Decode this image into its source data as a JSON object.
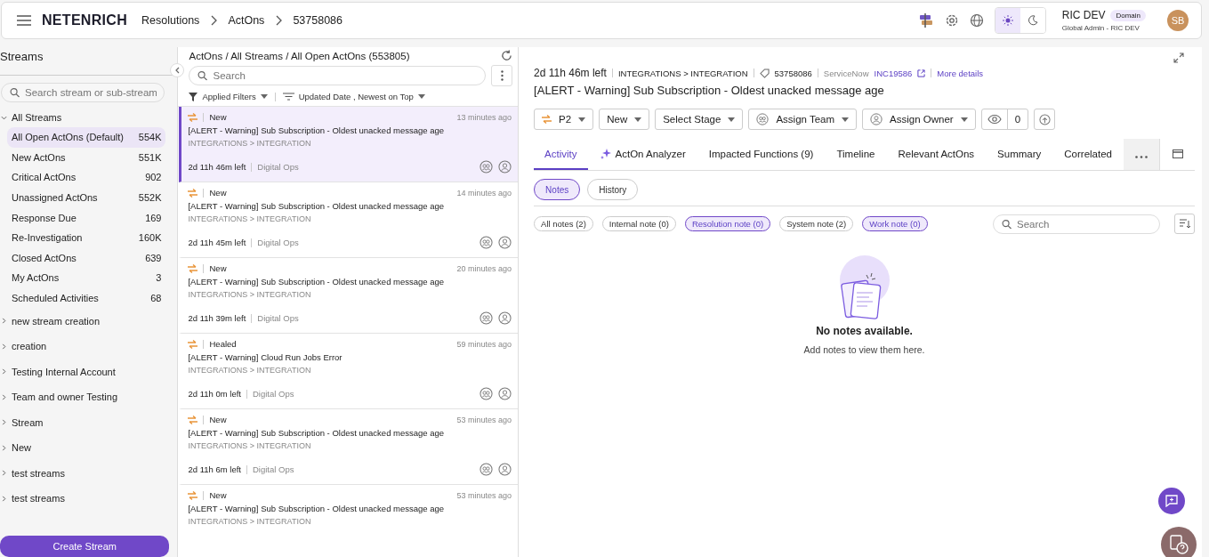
{
  "header": {
    "logo": "NETENRICH",
    "breadcrumbs": [
      "Resolutions",
      "ActOns",
      "53758086"
    ],
    "user": {
      "name": "RIC DEV",
      "badge": "Domain",
      "role": "Global Admin - RIC DEV",
      "initials": "SB"
    },
    "theme": {
      "light_selected": true
    }
  },
  "sidebar": {
    "title": "Streams",
    "search": {
      "placeholder": "Search stream or sub-stream"
    },
    "streams": [
      {
        "label": "All Streams",
        "expanded": true,
        "children": [
          {
            "label": "All Open ActOns (Default)",
            "count": "554K",
            "selected": true
          },
          {
            "label": "New ActOns",
            "count": "551K",
            "selected": false
          },
          {
            "label": "Critical ActOns",
            "count": "902",
            "selected": false
          },
          {
            "label": "Unassigned ActOns",
            "count": "552K",
            "selected": false
          },
          {
            "label": "Response Due",
            "count": "169",
            "selected": false
          },
          {
            "label": "Re-Investigation",
            "count": "160K",
            "selected": false
          },
          {
            "label": "Closed ActOns",
            "count": "639",
            "selected": false
          },
          {
            "label": "My ActOns",
            "count": "3",
            "selected": false
          },
          {
            "label": "Scheduled Activities",
            "count": "68",
            "selected": false
          }
        ]
      },
      {
        "label": "new stream creation",
        "expanded": false
      },
      {
        "label": "creation",
        "expanded": false
      },
      {
        "label": "Testing Internal Account",
        "expanded": false
      },
      {
        "label": "Team and owner Testing",
        "expanded": false
      },
      {
        "label": "Stream",
        "expanded": false
      },
      {
        "label": "New",
        "expanded": false
      },
      {
        "label": "test streams",
        "expanded": false
      },
      {
        "label": "test streams",
        "expanded": false
      }
    ],
    "create_button": "Create Stream"
  },
  "list": {
    "path": "ActOns / All Streams / All Open ActOns (553805)",
    "search": {
      "placeholder": "Search"
    },
    "filter": "Applied Filters",
    "sort": "Updated Date , Newest on Top",
    "items": [
      {
        "status": "New",
        "time": "13 minutes ago",
        "title": "[ALERT - Warning] Sub Subscription - Oldest unacked message age",
        "category": "INTEGRATIONS > INTEGRATION",
        "due": "2d 11h 46m left",
        "team": "Digital Ops",
        "selected": true
      },
      {
        "status": "New",
        "time": "14 minutes ago",
        "title": "[ALERT - Warning] Sub Subscription - Oldest unacked message age",
        "category": "INTEGRATIONS > INTEGRATION",
        "due": "2d 11h 45m left",
        "team": "Digital Ops",
        "selected": false
      },
      {
        "status": "New",
        "time": "20 minutes ago",
        "title": "[ALERT - Warning] Sub Subscription - Oldest unacked message age",
        "category": "INTEGRATIONS > INTEGRATION",
        "due": "2d 11h 39m left",
        "team": "Digital Ops",
        "selected": false
      },
      {
        "status": "Healed",
        "time": "59 minutes ago",
        "title": "[ALERT - Warning] Cloud Run Jobs Error",
        "category": "INTEGRATIONS > INTEGRATION",
        "due": "2d 11h 0m left",
        "team": "Digital Ops",
        "selected": false
      },
      {
        "status": "New",
        "time": "53 minutes ago",
        "title": "[ALERT - Warning] Sub Subscription - Oldest unacked message age",
        "category": "INTEGRATIONS > INTEGRATION",
        "due": "2d 11h 6m left",
        "team": "Digital Ops",
        "selected": false
      },
      {
        "status": "New",
        "time": "53 minutes ago",
        "title": "[ALERT - Warning] Sub Subscription - Oldest unacked message age",
        "category": "INTEGRATIONS > INTEGRATION",
        "selected": false
      }
    ]
  },
  "detail": {
    "due": "2d 11h 46m left",
    "category": "INTEGRATIONS > INTEGRATION",
    "id": "53758086",
    "source": "ServiceNow",
    "ticket": "INC19586",
    "more": "More details",
    "title": "[ALERT - Warning] Sub Subscription - Oldest unacked message age",
    "actions": [
      {
        "kind": "priority",
        "label": "P2"
      },
      {
        "kind": "dropdown",
        "label": "New"
      },
      {
        "kind": "dropdown",
        "label": "Select Stage"
      },
      {
        "kind": "team",
        "label": "Assign Team"
      },
      {
        "kind": "owner",
        "label": "Assign Owner"
      },
      {
        "kind": "views",
        "label": "0"
      },
      {
        "kind": "extra"
      }
    ],
    "tabs": [
      {
        "label": "Activity",
        "selected": true
      },
      {
        "label": "ActOn Analyzer",
        "selected": false,
        "kind": "sparkle"
      },
      {
        "label": "Impacted Functions (9)",
        "selected": false
      },
      {
        "label": "Timeline",
        "selected": false
      },
      {
        "label": "Relevant ActOns",
        "selected": false
      },
      {
        "label": "Summary",
        "selected": false
      },
      {
        "label": "Correlated",
        "selected": false
      }
    ],
    "subtabs": [
      {
        "label": "Notes",
        "selected": true
      },
      {
        "label": "History",
        "selected": false
      }
    ],
    "note_filters": [
      {
        "label": "All notes (2)",
        "selected": false
      },
      {
        "label": "Internal note (0)",
        "selected": false
      },
      {
        "label": "Resolution note (0)",
        "selected": true
      },
      {
        "label": "System note (2)",
        "selected": false
      },
      {
        "label": "Work note (0)",
        "selected": true
      }
    ],
    "notes_search": {
      "placeholder": "Search"
    },
    "empty": {
      "title": "No notes available.",
      "text": "Add notes to view them here."
    }
  }
}
